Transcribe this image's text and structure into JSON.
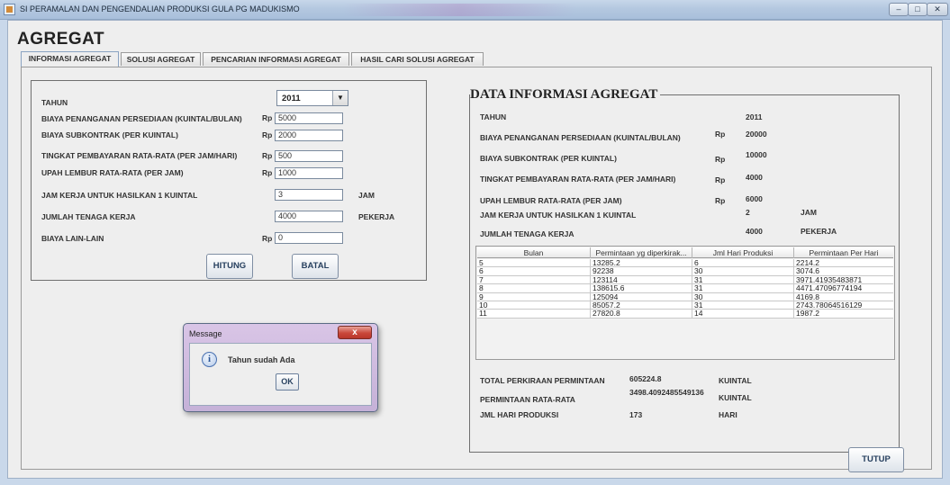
{
  "window": {
    "title": "SI PERAMALAN DAN PENGENDALIAN PRODUKSI GULA PG MADUKISMO",
    "minimize": "–",
    "restore": "□",
    "close": "✕"
  },
  "page_title": "AGREGAT",
  "tabs": [
    {
      "label": "INFORMASI AGREGAT",
      "active": true
    },
    {
      "label": "SOLUSI AGREGAT",
      "active": false
    },
    {
      "label": "PENCARIAN INFORMASI AGREGAT",
      "active": false
    },
    {
      "label": "HASIL CARI SOLUSI AGREGAT",
      "active": false
    }
  ],
  "form": {
    "tahun": {
      "label": "TAHUN",
      "value": "2011",
      "dropdown_icon": "▼"
    },
    "biaya_penanganan": {
      "label": "BIAYA PENANGANAN PERSEDIAAN (KUINTAL/BULAN)",
      "currency": "Rp",
      "value": "5000"
    },
    "biaya_subkontrak": {
      "label": "BIAYA SUBKONTRAK (PER KUINTAL)",
      "currency": "Rp",
      "value": "2000"
    },
    "tingkat_pembayaran": {
      "label": "TINGKAT PEMBAYARAN RATA-RATA (PER JAM/HARI)",
      "currency": "Rp",
      "value": "500"
    },
    "upah_lembur": {
      "label": "UPAH LEMBUR RATA-RATA (PER JAM)",
      "currency": "Rp",
      "value": "1000"
    },
    "jam_kerja": {
      "label": "JAM KERJA UNTUK HASILKAN 1 KUINTAL",
      "value": "3",
      "unit": "JAM"
    },
    "tenaga_kerja": {
      "label": "JUMLAH TENAGA KERJA",
      "value": "4000",
      "unit": "PEKERJA"
    },
    "biaya_lain": {
      "label": "BIAYA LAIN-LAIN",
      "currency": "Rp",
      "value": "0"
    },
    "hitung_label": "HITUNG",
    "batal_label": "BATAL"
  },
  "data_info": {
    "title": "DATA INFORMASI AGREGAT",
    "tahun": {
      "label": "TAHUN",
      "value": "2011"
    },
    "biaya_penanganan": {
      "label": "BIAYA PENANGANAN PERSEDIAAN (KUINTAL/BULAN)",
      "currency": "Rp",
      "value": "20000"
    },
    "biaya_subkontrak": {
      "label": "BIAYA SUBKONTRAK (PER KUINTAL)",
      "currency": "Rp",
      "value": "10000"
    },
    "tingkat_pembayaran": {
      "label": "TINGKAT PEMBAYARAN RATA-RATA (PER JAM/HARI)",
      "currency": "Rp",
      "value": "4000"
    },
    "upah_lembur": {
      "label": "UPAH LEMBUR RATA-RATA (PER JAM)",
      "currency": "Rp",
      "value": "6000"
    },
    "jam_kerja": {
      "label": "JAM KERJA UNTUK HASILKAN 1 KUINTAL",
      "value": "2",
      "unit": "JAM"
    },
    "tenaga_kerja": {
      "label": "JUMLAH TENAGA KERJA",
      "value": "4000",
      "unit": "PEKERJA"
    },
    "table": {
      "columns": [
        "Bulan",
        "Permintaan yg diperkirak...",
        "Jml Hari Produksi",
        "Permintaan Per Hari"
      ],
      "rows": [
        [
          "5",
          "13285.2",
          "6",
          "2214.2"
        ],
        [
          "6",
          "92238",
          "30",
          "3074.6"
        ],
        [
          "7",
          "123114",
          "31",
          "3971.41935483871"
        ],
        [
          "8",
          "138615.6",
          "31",
          "4471.47096774194"
        ],
        [
          "9",
          "125094",
          "30",
          "4169.8"
        ],
        [
          "10",
          "85057.2",
          "31",
          "2743.78064516129"
        ],
        [
          "11",
          "27820.8",
          "14",
          "1987.2"
        ]
      ]
    },
    "total": {
      "label": "TOTAL PERKIRAAN PERMINTAAN",
      "value": "605224.8",
      "unit": "KUINTAL"
    },
    "rata_rata": {
      "label": "PERMINTAAN RATA-RATA",
      "value": "3498.4092485549136",
      "unit": "KUINTAL"
    },
    "hari_produksi": {
      "label": "JML HARI  PRODUKSI",
      "value": "173",
      "unit": "HARI"
    }
  },
  "tutup_label": "TUTUP",
  "dialog": {
    "title": "Message",
    "close": "x",
    "icon": "i",
    "message": "Tahun sudah Ada",
    "ok_label": "OK"
  }
}
